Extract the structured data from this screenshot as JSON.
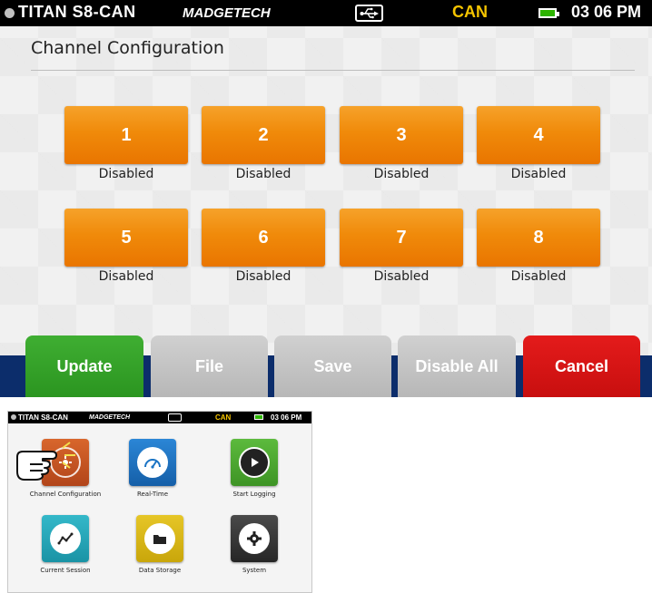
{
  "status_bar": {
    "device": "TITAN S8-CAN",
    "brand": "MADGETECH",
    "mode": "CAN",
    "time": "03 06 PM",
    "icons": [
      "status-dot-icon",
      "usb-icon",
      "battery-icon"
    ]
  },
  "page": {
    "title": "Channel Configuration"
  },
  "channels": [
    {
      "number": "1",
      "state": "Disabled"
    },
    {
      "number": "2",
      "state": "Disabled"
    },
    {
      "number": "3",
      "state": "Disabled"
    },
    {
      "number": "4",
      "state": "Disabled"
    },
    {
      "number": "5",
      "state": "Disabled"
    },
    {
      "number": "6",
      "state": "Disabled"
    },
    {
      "number": "7",
      "state": "Disabled"
    },
    {
      "number": "8",
      "state": "Disabled"
    }
  ],
  "actions": {
    "update": "Update",
    "file": "File",
    "save": "Save",
    "disable_all": "Disable All",
    "cancel": "Cancel"
  },
  "colors": {
    "channel_button": "#f08a0a",
    "update": "#2b9520",
    "disabled_action": "#c4c4c4",
    "cancel": "#d41414",
    "bottom_band": "#0c2d6b",
    "status_mode": "#f5c400"
  },
  "home_screen": {
    "status_bar": {
      "device": "TITAN S8-CAN",
      "brand": "MADGETECH",
      "mode": "CAN",
      "time": "03 06 PM"
    },
    "apps": [
      {
        "label": "Channel Configuration",
        "icon": "channel-configuration-icon",
        "color": "#c8531e"
      },
      {
        "label": "Real-Time",
        "icon": "gauge-icon",
        "color": "#1b74c4"
      },
      {
        "label": "Start Logging",
        "icon": "play-icon",
        "color": "#4ea832"
      },
      {
        "label": "Current Session",
        "icon": "graph-icon",
        "color": "#23a6b8"
      },
      {
        "label": "Data Storage",
        "icon": "folder-icon",
        "color": "#d9b814"
      },
      {
        "label": "System",
        "icon": "gear-icon",
        "color": "#3a3a3a"
      }
    ],
    "pointer": "pointing-hand-icon"
  }
}
